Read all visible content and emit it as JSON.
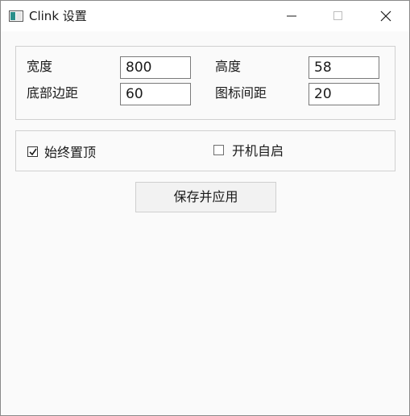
{
  "window": {
    "title": "Clink 设置",
    "icons": {
      "app": "window-app-icon",
      "minimize": "minimize-icon",
      "maximize": "maximize-icon",
      "close": "close-icon"
    }
  },
  "size_settings": {
    "width_label": "宽度",
    "width_value": "800",
    "height_label": "高度",
    "height_value": "58",
    "bottom_margin_label": "底部边距",
    "bottom_margin_value": "60",
    "icon_spacing_label": "图标间距",
    "icon_spacing_value": "20"
  },
  "options": {
    "always_on_top": {
      "label": "始终置顶",
      "checked": true
    },
    "auto_start": {
      "label": "开机自启",
      "checked": false
    }
  },
  "actions": {
    "save_label": "保存并应用"
  },
  "colors": {
    "window_bg": "#fafafa",
    "titlebar_bg": "#ffffff",
    "border": "#d0d0d0",
    "accent_icon": "#2a8f8a"
  }
}
